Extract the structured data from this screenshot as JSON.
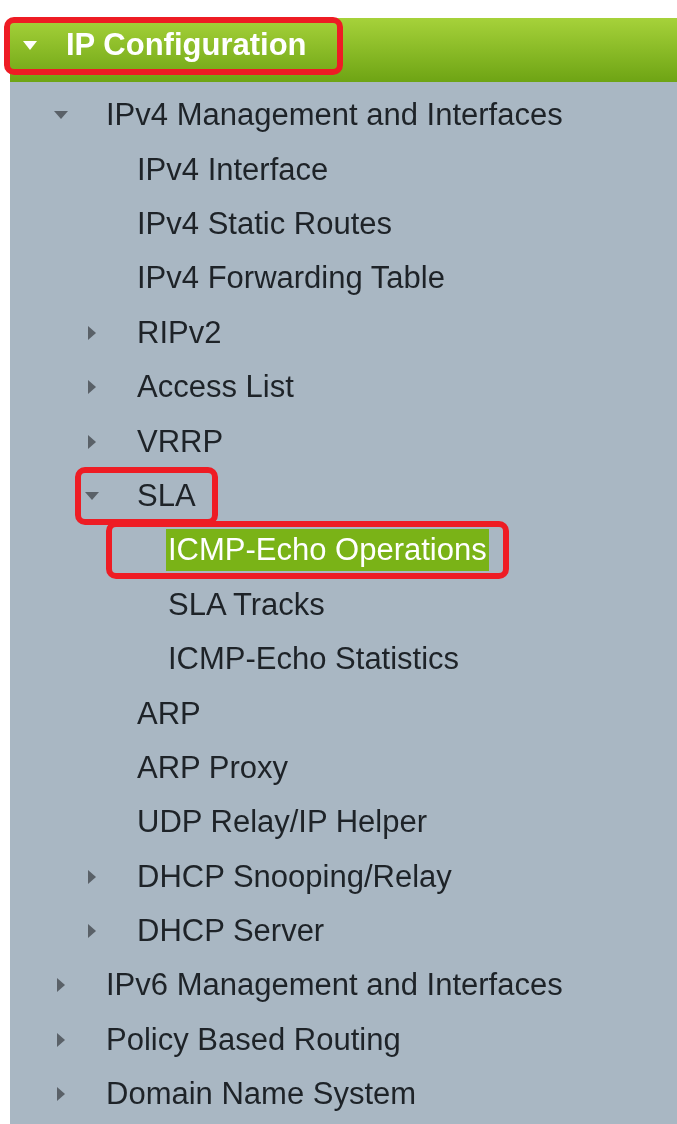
{
  "section": {
    "title": "IP Configuration",
    "expanded": true,
    "annotated": true
  },
  "tree": [
    {
      "label": "IPv4 Management and Interfaces",
      "expanded": true,
      "selected": false,
      "annotated": false,
      "children": [
        {
          "label": "IPv4 Interface",
          "selected": false,
          "annotated": false
        },
        {
          "label": "IPv4 Static Routes",
          "selected": false,
          "annotated": false
        },
        {
          "label": "IPv4 Forwarding Table",
          "selected": false,
          "annotated": false
        },
        {
          "label": "RIPv2",
          "expanded": false,
          "selected": false,
          "annotated": false
        },
        {
          "label": "Access List",
          "expanded": false,
          "selected": false,
          "annotated": false
        },
        {
          "label": "VRRP",
          "expanded": false,
          "selected": false,
          "annotated": false
        },
        {
          "label": "SLA",
          "expanded": true,
          "selected": false,
          "annotated": true,
          "children": [
            {
              "label": "ICMP-Echo Operations",
              "selected": true,
              "annotated": true
            },
            {
              "label": "SLA Tracks",
              "selected": false,
              "annotated": false
            },
            {
              "label": "ICMP-Echo Statistics",
              "selected": false,
              "annotated": false
            }
          ]
        },
        {
          "label": "ARP",
          "selected": false,
          "annotated": false
        },
        {
          "label": "ARP Proxy",
          "selected": false,
          "annotated": false
        },
        {
          "label": "UDP Relay/IP Helper",
          "selected": false,
          "annotated": false
        },
        {
          "label": "DHCP Snooping/Relay",
          "expanded": false,
          "selected": false,
          "annotated": false
        },
        {
          "label": "DHCP Server",
          "expanded": false,
          "selected": false,
          "annotated": false
        }
      ]
    },
    {
      "label": "IPv6 Management and Interfaces",
      "expanded": false,
      "selected": false,
      "annotated": false
    },
    {
      "label": "Policy Based Routing",
      "expanded": false,
      "selected": false,
      "annotated": false
    },
    {
      "label": "Domain Name System",
      "expanded": false,
      "selected": false,
      "annotated": false
    }
  ]
}
